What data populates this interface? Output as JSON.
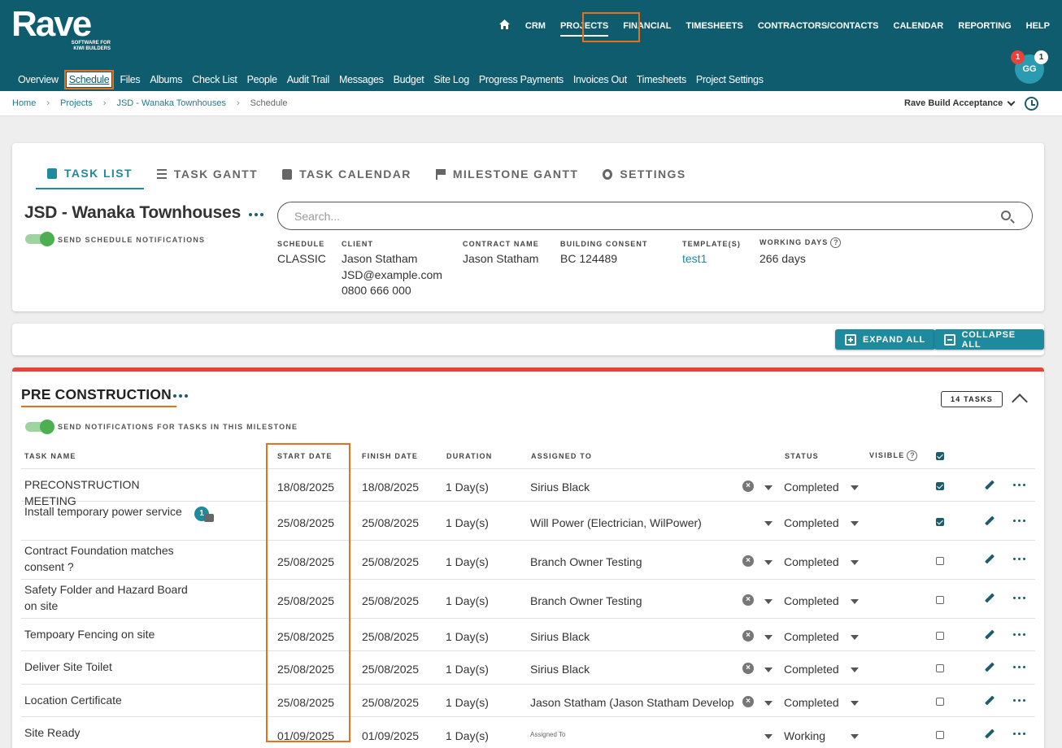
{
  "brand": {
    "name": "Rave",
    "tagline_line1": "SOFTWARE FOR",
    "tagline_line2": "KIWI BUILDERS"
  },
  "main_nav": {
    "home_icon": "home-icon",
    "items": [
      "CRM",
      "PROJECTS",
      "FINANCIAL",
      "TIMESHEETS",
      "CONTRACTORS/CONTACTS",
      "CALENDAR",
      "REPORTING",
      "HELP"
    ],
    "active": "PROJECTS"
  },
  "sub_nav": {
    "items": [
      "Overview",
      "Schedule",
      "Files",
      "Albums",
      "Check List",
      "People",
      "Audit Trail",
      "Messages",
      "Budget",
      "Site Log",
      "Progress Payments",
      "Invoices Out",
      "Timesheets",
      "Project Settings"
    ],
    "active": "Schedule"
  },
  "user": {
    "initials": "GG",
    "badge_red": "1",
    "badge_white": "1"
  },
  "breadcrumb": {
    "home": "Home",
    "projects": "Projects",
    "project": "JSD - Wanaka Townhouses",
    "current": "Schedule"
  },
  "company_selector": "Rave Build Acceptance",
  "tabs": [
    "TASK LIST",
    "TASK GANTT",
    "TASK CALENDAR",
    "MILESTONE GANTT",
    "SETTINGS"
  ],
  "project": {
    "title": "JSD - Wanaka Townhouses",
    "notif_label": "SEND SCHEDULE NOTIFICATIONS",
    "notif_on": true,
    "search_placeholder": "Search...",
    "meta": {
      "schedule_label": "SCHEDULE",
      "schedule": "CLASSIC",
      "client_label": "CLIENT",
      "client_name": "Jason Statham",
      "client_email": "JSD@example.com",
      "client_phone": "0800 666 000",
      "contract_label": "CONTRACT NAME",
      "contract": "Jason Statham",
      "consent_label": "BUILDING CONSENT",
      "consent": "BC 124489",
      "template_label": "TEMPLATE(S)",
      "template": "test1",
      "working_label": "WORKING DAYS",
      "working": "266 days",
      "help": "?"
    }
  },
  "actions": {
    "expand_all": "EXPAND ALL",
    "collapse_all": "COLLAPSE ALL"
  },
  "milestone": {
    "title": "PRE CONSTRUCTION",
    "notif_label": "SEND NOTIFICATIONS FOR TASKS IN THIS MILESTONE",
    "task_count": "14 TASKS",
    "accent": "#e8423a",
    "columns": {
      "name": "TASK NAME",
      "start": "START DATE",
      "finish": "FINISH DATE",
      "duration": "DURATION",
      "assigned": "ASSIGNED TO",
      "status": "STATUS",
      "visible": "VISIBLE",
      "help": "?"
    },
    "tasks": [
      {
        "name": "PRECONSTRUCTION MEETING",
        "start": "18/08/2025",
        "finish": "18/08/2025",
        "duration": "1 Day(s)",
        "assigned": "Sirius Black",
        "status": "Completed",
        "visible": true
      },
      {
        "name": "Install temporary power service",
        "start": "25/08/2025",
        "finish": "25/08/2025",
        "duration": "1 Day(s)",
        "assigned": "Will Power (Electrician, WilPower)",
        "status": "Completed",
        "visible": true,
        "comments": "1"
      },
      {
        "name": "Contract Foundation matches consent ?",
        "start": "25/08/2025",
        "finish": "25/08/2025",
        "duration": "1 Day(s)",
        "assigned": "Branch Owner Testing",
        "status": "Completed",
        "visible": false
      },
      {
        "name": "Safety Folder and Hazard Board on site",
        "start": "25/08/2025",
        "finish": "25/08/2025",
        "duration": "1 Day(s)",
        "assigned": "Branch Owner Testing",
        "status": "Completed",
        "visible": false
      },
      {
        "name": "Tempoary Fencing on site",
        "start": "25/08/2025",
        "finish": "25/08/2025",
        "duration": "1 Day(s)",
        "assigned": "Sirius Black",
        "status": "Completed",
        "visible": false
      },
      {
        "name": "Deliver Site Toilet",
        "start": "25/08/2025",
        "finish": "25/08/2025",
        "duration": "1 Day(s)",
        "assigned": "Sirius Black",
        "status": "Completed",
        "visible": false
      },
      {
        "name": "Location Certificate",
        "start": "25/08/2025",
        "finish": "25/08/2025",
        "duration": "1 Day(s)",
        "assigned": "Jason Statham (Jason Statham Develop",
        "status": "Completed",
        "visible": false
      },
      {
        "name": "Site Ready",
        "start": "01/09/2025",
        "finish": "01/09/2025",
        "duration": "1 Day(s)",
        "assigned_placeholder": "Assigned To",
        "status": "Working",
        "visible": false
      }
    ]
  }
}
